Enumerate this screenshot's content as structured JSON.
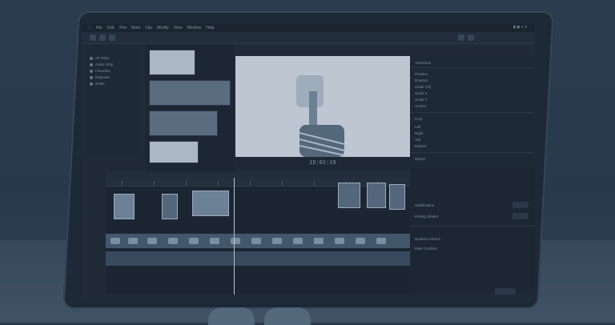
{
  "menu": {
    "items": [
      "File",
      "Edit",
      "Trim",
      "Mark",
      "Clip",
      "Modify",
      "View",
      "Window",
      "Help"
    ]
  },
  "viewer": {
    "timecode": "15:02:19"
  },
  "libraries": {
    "items": [
      {
        "label": "All Video",
        "icon": "film-icon"
      },
      {
        "label": "Audio Only",
        "icon": "audio-icon"
      },
      {
        "label": "Favorites",
        "icon": "star-icon"
      },
      {
        "label": "Rejected",
        "icon": "reject-icon"
      },
      {
        "label": "Roles",
        "icon": "role-icon"
      }
    ]
  },
  "inspector": {
    "rows": [
      "Transform",
      "Position",
      "Rotation",
      "Scale (All)",
      "Scale X",
      "Scale Y",
      "Anchor",
      "Crop",
      "Left",
      "Right",
      "Top",
      "Bottom",
      "Distort"
    ]
  },
  "right_panel": {
    "rows": [
      "Stabilization",
      "Rolling Shutter",
      "Spatial Conform",
      "Rate Conform"
    ]
  }
}
